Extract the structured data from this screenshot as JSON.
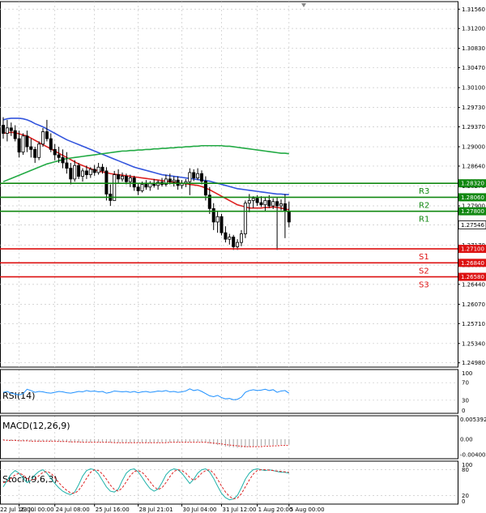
{
  "chart_data": {
    "type": "candlestick",
    "price_axis": {
      "ticks": [
        "1.31560",
        "1.31200",
        "1.30830",
        "1.30470",
        "1.30100",
        "1.29730",
        "1.29370",
        "1.29000",
        "1.28640",
        "1.28270",
        "1.27900",
        "1.27546",
        "1.27170",
        "1.26800",
        "1.26440",
        "1.26070",
        "1.25710",
        "1.25340",
        "1.24980"
      ],
      "ylim": [
        1.249,
        1.317
      ]
    },
    "time_axis": {
      "labels": [
        "22 Jul 16:00",
        "23 Jul 00:00",
        "24 Jul 08:00",
        "25 Jul 16:00",
        "28 Jul 21:01",
        "30 Jul 04:00",
        "31 Jul 12:00",
        "1 Aug 20:00",
        "5 Aug 00:00"
      ],
      "n_bars": 73
    },
    "candles": [
      {
        "o": 1.294,
        "h": 1.2955,
        "l": 1.2915,
        "c": 1.2925
      },
      {
        "o": 1.2925,
        "h": 1.295,
        "l": 1.291,
        "c": 1.2935
      },
      {
        "o": 1.2935,
        "h": 1.2945,
        "l": 1.292,
        "c": 1.293
      },
      {
        "o": 1.293,
        "h": 1.294,
        "l": 1.291,
        "c": 1.2915
      },
      {
        "o": 1.2915,
        "h": 1.293,
        "l": 1.288,
        "c": 1.289
      },
      {
        "o": 1.289,
        "h": 1.2925,
        "l": 1.2885,
        "c": 1.292
      },
      {
        "o": 1.292,
        "h": 1.293,
        "l": 1.289,
        "c": 1.29
      },
      {
        "o": 1.29,
        "h": 1.2915,
        "l": 1.288,
        "c": 1.2895
      },
      {
        "o": 1.2895,
        "h": 1.29,
        "l": 1.287,
        "c": 1.288
      },
      {
        "o": 1.288,
        "h": 1.291,
        "l": 1.2875,
        "c": 1.2905
      },
      {
        "o": 1.2905,
        "h": 1.2935,
        "l": 1.29,
        "c": 1.2928
      },
      {
        "o": 1.2928,
        "h": 1.295,
        "l": 1.291,
        "c": 1.2915
      },
      {
        "o": 1.2915,
        "h": 1.2925,
        "l": 1.289,
        "c": 1.2895
      },
      {
        "o": 1.2895,
        "h": 1.2905,
        "l": 1.2875,
        "c": 1.2885
      },
      {
        "o": 1.2885,
        "h": 1.29,
        "l": 1.287,
        "c": 1.288
      },
      {
        "o": 1.288,
        "h": 1.2895,
        "l": 1.286,
        "c": 1.287
      },
      {
        "o": 1.287,
        "h": 1.289,
        "l": 1.285,
        "c": 1.286
      },
      {
        "o": 1.286,
        "h": 1.287,
        "l": 1.283,
        "c": 1.284
      },
      {
        "o": 1.284,
        "h": 1.2875,
        "l": 1.2835,
        "c": 1.2865
      },
      {
        "o": 1.2865,
        "h": 1.287,
        "l": 1.284,
        "c": 1.2845
      },
      {
        "o": 1.2845,
        "h": 1.286,
        "l": 1.2835,
        "c": 1.2855
      },
      {
        "o": 1.2855,
        "h": 1.2865,
        "l": 1.284,
        "c": 1.2848
      },
      {
        "o": 1.2848,
        "h": 1.2862,
        "l": 1.2842,
        "c": 1.2858
      },
      {
        "o": 1.2858,
        "h": 1.2866,
        "l": 1.2846,
        "c": 1.2852
      },
      {
        "o": 1.2852,
        "h": 1.287,
        "l": 1.2848,
        "c": 1.2862
      },
      {
        "o": 1.2862,
        "h": 1.2868,
        "l": 1.285,
        "c": 1.2855
      },
      {
        "o": 1.2855,
        "h": 1.2862,
        "l": 1.28,
        "c": 1.2812
      },
      {
        "o": 1.2812,
        "h": 1.283,
        "l": 1.279,
        "c": 1.28
      },
      {
        "o": 1.28,
        "h": 1.2855,
        "l": 1.28,
        "c": 1.2848
      },
      {
        "o": 1.2848,
        "h": 1.2858,
        "l": 1.2832,
        "c": 1.284
      },
      {
        "o": 1.284,
        "h": 1.2852,
        "l": 1.2835,
        "c": 1.2845
      },
      {
        "o": 1.2845,
        "h": 1.285,
        "l": 1.283,
        "c": 1.2835
      },
      {
        "o": 1.2835,
        "h": 1.2848,
        "l": 1.2825,
        "c": 1.2842
      },
      {
        "o": 1.2842,
        "h": 1.2846,
        "l": 1.2818,
        "c": 1.2825
      },
      {
        "o": 1.2825,
        "h": 1.2832,
        "l": 1.281,
        "c": 1.2818
      },
      {
        "o": 1.2818,
        "h": 1.2835,
        "l": 1.2815,
        "c": 1.283
      },
      {
        "o": 1.283,
        "h": 1.2838,
        "l": 1.282,
        "c": 1.2825
      },
      {
        "o": 1.2825,
        "h": 1.2836,
        "l": 1.2818,
        "c": 1.2832
      },
      {
        "o": 1.2832,
        "h": 1.284,
        "l": 1.2824,
        "c": 1.2828
      },
      {
        "o": 1.2828,
        "h": 1.2838,
        "l": 1.282,
        "c": 1.2834
      },
      {
        "o": 1.2834,
        "h": 1.2842,
        "l": 1.2826,
        "c": 1.283
      },
      {
        "o": 1.283,
        "h": 1.2848,
        "l": 1.2826,
        "c": 1.284
      },
      {
        "o": 1.284,
        "h": 1.285,
        "l": 1.283,
        "c": 1.2835
      },
      {
        "o": 1.2835,
        "h": 1.2845,
        "l": 1.2826,
        "c": 1.2838
      },
      {
        "o": 1.2838,
        "h": 1.2845,
        "l": 1.282,
        "c": 1.2828
      },
      {
        "o": 1.2828,
        "h": 1.2838,
        "l": 1.2822,
        "c": 1.2832
      },
      {
        "o": 1.2832,
        "h": 1.284,
        "l": 1.2825,
        "c": 1.2835
      },
      {
        "o": 1.2835,
        "h": 1.286,
        "l": 1.281,
        "c": 1.2852
      },
      {
        "o": 1.2852,
        "h": 1.2858,
        "l": 1.2836,
        "c": 1.2842
      },
      {
        "o": 1.2842,
        "h": 1.286,
        "l": 1.2838,
        "c": 1.285
      },
      {
        "o": 1.285,
        "h": 1.2856,
        "l": 1.283,
        "c": 1.2836
      },
      {
        "o": 1.2836,
        "h": 1.2845,
        "l": 1.28,
        "c": 1.281
      },
      {
        "o": 1.281,
        "h": 1.2825,
        "l": 1.2775,
        "c": 1.2785
      },
      {
        "o": 1.2785,
        "h": 1.2795,
        "l": 1.2745,
        "c": 1.276
      },
      {
        "o": 1.276,
        "h": 1.278,
        "l": 1.274,
        "c": 1.277
      },
      {
        "o": 1.277,
        "h": 1.2775,
        "l": 1.2735,
        "c": 1.274
      },
      {
        "o": 1.274,
        "h": 1.2752,
        "l": 1.2722,
        "c": 1.2728
      },
      {
        "o": 1.2728,
        "h": 1.2738,
        "l": 1.2718,
        "c": 1.2732
      },
      {
        "o": 1.2732,
        "h": 1.2736,
        "l": 1.2708,
        "c": 1.2714
      },
      {
        "o": 1.2714,
        "h": 1.2728,
        "l": 1.2708,
        "c": 1.2722
      },
      {
        "o": 1.2722,
        "h": 1.2745,
        "l": 1.2715,
        "c": 1.2738
      },
      {
        "o": 1.2738,
        "h": 1.28,
        "l": 1.273,
        "c": 1.2795
      },
      {
        "o": 1.2795,
        "h": 1.2812,
        "l": 1.2778,
        "c": 1.28
      },
      {
        "o": 1.28,
        "h": 1.2808,
        "l": 1.2786,
        "c": 1.2804
      },
      {
        "o": 1.2804,
        "h": 1.281,
        "l": 1.279,
        "c": 1.2796
      },
      {
        "o": 1.2796,
        "h": 1.2808,
        "l": 1.2788,
        "c": 1.2792
      },
      {
        "o": 1.2792,
        "h": 1.2806,
        "l": 1.278,
        "c": 1.28
      },
      {
        "o": 1.28,
        "h": 1.281,
        "l": 1.2786,
        "c": 1.279
      },
      {
        "o": 1.279,
        "h": 1.2804,
        "l": 1.2784,
        "c": 1.2798
      },
      {
        "o": 1.2798,
        "h": 1.2806,
        "l": 1.2708,
        "c": 1.279
      },
      {
        "o": 1.279,
        "h": 1.2802,
        "l": 1.2782,
        "c": 1.2794
      },
      {
        "o": 1.2794,
        "h": 1.2812,
        "l": 1.273,
        "c": 1.278
      },
      {
        "o": 1.278,
        "h": 1.2798,
        "l": 1.275,
        "c": 1.276
      }
    ],
    "moving_averages": [
      {
        "color": "#3355dd",
        "values": [
          1.295,
          1.2952,
          1.2953,
          1.2953,
          1.2953,
          1.2952,
          1.295,
          1.2947,
          1.2943,
          1.294,
          1.2937,
          1.2933,
          1.2929,
          1.2925,
          1.2921,
          1.2917,
          1.2913,
          1.291,
          1.2907,
          1.2904,
          1.2901,
          1.2898,
          1.2895,
          1.2892,
          1.2889,
          1.2886,
          1.2883,
          1.288,
          1.2877,
          1.2874,
          1.2871,
          1.2868,
          1.2865,
          1.2862,
          1.286,
          1.2858,
          1.2856,
          1.2854,
          1.2852,
          1.285,
          1.2848,
          1.2847,
          1.2846,
          1.2845,
          1.2844,
          1.2843,
          1.2842,
          1.2841,
          1.284,
          1.2839,
          1.2838,
          1.2837,
          1.2836,
          1.2834,
          1.2832,
          1.283,
          1.2828,
          1.2826,
          1.2824,
          1.2822,
          1.2821,
          1.282,
          1.2819,
          1.2818,
          1.2817,
          1.2816,
          1.2815,
          1.2814,
          1.2813,
          1.2812,
          1.2812,
          1.2811,
          1.2811
        ]
      },
      {
        "color": "#dd2222",
        "values": [
          1.2925,
          1.2926,
          1.2927,
          1.2926,
          1.2924,
          1.2922,
          1.292,
          1.2916,
          1.2912,
          1.2908,
          1.2904,
          1.29,
          1.2896,
          1.2892,
          1.2888,
          1.2884,
          1.288,
          1.2876,
          1.2872,
          1.2868,
          1.2865,
          1.2862,
          1.2859,
          1.2857,
          1.2855,
          1.2853,
          1.2852,
          1.285,
          1.2849,
          1.2848,
          1.2847,
          1.2846,
          1.2845,
          1.2844,
          1.2843,
          1.2842,
          1.2841,
          1.284,
          1.2839,
          1.2838,
          1.2837,
          1.2836,
          1.2835,
          1.2834,
          1.2833,
          1.2832,
          1.2831,
          1.283,
          1.2829,
          1.2828,
          1.2826,
          1.2823,
          1.282,
          1.2816,
          1.2812,
          1.2808,
          1.2804,
          1.28,
          1.2796,
          1.2792,
          1.279,
          1.2788,
          1.2786,
          1.2786,
          1.2786,
          1.2786,
          1.2787,
          1.2787,
          1.2788,
          1.2787,
          1.2786,
          1.2784,
          1.2783
        ]
      },
      {
        "color": "#22aa44",
        "values": [
          1.2835,
          1.2838,
          1.2841,
          1.2844,
          1.2847,
          1.285,
          1.2853,
          1.2856,
          1.2859,
          1.2862,
          1.2865,
          1.2868,
          1.287,
          1.2872,
          1.2874,
          1.2876,
          1.2878,
          1.2879,
          1.288,
          1.2881,
          1.2882,
          1.2883,
          1.2884,
          1.2885,
          1.2886,
          1.2887,
          1.2888,
          1.2889,
          1.289,
          1.2891,
          1.2892,
          1.2892,
          1.2893,
          1.2893,
          1.2894,
          1.2894,
          1.2895,
          1.2895,
          1.2896,
          1.2896,
          1.2897,
          1.2897,
          1.2898,
          1.2898,
          1.2899,
          1.2899,
          1.29,
          1.29,
          1.2901,
          1.2901,
          1.2902,
          1.2902,
          1.2902,
          1.2902,
          1.2902,
          1.2902,
          1.2901,
          1.2901,
          1.29,
          1.2899,
          1.2898,
          1.2897,
          1.2896,
          1.2895,
          1.2894,
          1.2893,
          1.2892,
          1.2891,
          1.289,
          1.2889,
          1.2888,
          1.2888,
          1.2887
        ]
      }
    ],
    "levels": [
      {
        "label": "R3",
        "value": 1.2832,
        "tag": "1.28320",
        "color": "#118811",
        "tag_bg": "#118811"
      },
      {
        "label": "R2",
        "value": 1.2806,
        "tag": "1.28060",
        "color": "#118811",
        "tag_bg": "#118811"
      },
      {
        "label": "R1",
        "value": 1.278,
        "tag": "1.27800",
        "color": "#118811",
        "tag_bg": "#118811"
      },
      {
        "label": "S1",
        "value": 1.271,
        "tag": "1.27100",
        "color": "#dd1111",
        "tag_bg": "#dd1111"
      },
      {
        "label": "S2",
        "value": 1.2684,
        "tag": "1.26840",
        "color": "#dd1111",
        "tag_bg": "#dd1111"
      },
      {
        "label": "S3",
        "value": 1.2658,
        "tag": "1.26580",
        "color": "#dd1111",
        "tag_bg": "#dd1111"
      }
    ],
    "current_price": {
      "value": 1.27546,
      "tag": "1.27546"
    },
    "rsi": {
      "title": "RSI(14)",
      "ticks": [
        "100",
        "70",
        "30",
        "0"
      ],
      "ylim": [
        0,
        100
      ],
      "color": "#1e90ff",
      "values": [
        48,
        50,
        46,
        44,
        42,
        45,
        55,
        52,
        48,
        50,
        49,
        47,
        46,
        48,
        50,
        49,
        47,
        46,
        48,
        50,
        49,
        52,
        50,
        51,
        49,
        50,
        46,
        48,
        51,
        50,
        49,
        50,
        48,
        50,
        47,
        49,
        50,
        48,
        49,
        51,
        50,
        52,
        49,
        50,
        48,
        49,
        51,
        56,
        52,
        54,
        50,
        45,
        40,
        38,
        41,
        36,
        33,
        34,
        31,
        32,
        37,
        48,
        52,
        54,
        52,
        53,
        55,
        52,
        54,
        48,
        51,
        52,
        46
      ]
    },
    "macd": {
      "title": "MACD(12,26,9)",
      "ticks": [
        "0.005392",
        "0.00",
        "-0.004007"
      ],
      "ylim": [
        -0.005,
        0.006
      ],
      "hist_color": "#b0b0b0",
      "signal_color": "#dd2222",
      "hist": [
        -0.0003,
        -0.0003,
        -0.0004,
        -0.0004,
        -0.0005,
        -0.0005,
        -0.0005,
        -0.0005,
        -0.0006,
        -0.0006,
        -0.0005,
        -0.0005,
        -0.0005,
        -0.0006,
        -0.0006,
        -0.0007,
        -0.0007,
        -0.0008,
        -0.0008,
        -0.0008,
        -0.0008,
        -0.0008,
        -0.0008,
        -0.0008,
        -0.0008,
        -0.0008,
        -0.0009,
        -0.0009,
        -0.0009,
        -0.0009,
        -0.0009,
        -0.0009,
        -0.0009,
        -0.0009,
        -0.0009,
        -0.0009,
        -0.0009,
        -0.0009,
        -0.0009,
        -0.0009,
        -0.0008,
        -0.0008,
        -0.0008,
        -0.0008,
        -0.0008,
        -0.0008,
        -0.0008,
        -0.0007,
        -0.0007,
        -0.0007,
        -0.0008,
        -0.0009,
        -0.0011,
        -0.0013,
        -0.0015,
        -0.0017,
        -0.0019,
        -0.002,
        -0.0021,
        -0.0022,
        -0.0022,
        -0.0021,
        -0.002,
        -0.0019,
        -0.0018,
        -0.0017,
        -0.0016,
        -0.0016,
        -0.0015,
        -0.0015,
        -0.0014,
        -0.0014,
        -0.0014
      ],
      "signal": [
        -0.0002,
        -0.0003,
        -0.0003,
        -0.0003,
        -0.0004,
        -0.0004,
        -0.0004,
        -0.0005,
        -0.0005,
        -0.0005,
        -0.0005,
        -0.0005,
        -0.0005,
        -0.0005,
        -0.0006,
        -0.0006,
        -0.0006,
        -0.0007,
        -0.0007,
        -0.0007,
        -0.0008,
        -0.0008,
        -0.0008,
        -0.0008,
        -0.0008,
        -0.0008,
        -0.0008,
        -0.0008,
        -0.0009,
        -0.0009,
        -0.0009,
        -0.0009,
        -0.0009,
        -0.0009,
        -0.0009,
        -0.0009,
        -0.0009,
        -0.0009,
        -0.0009,
        -0.0009,
        -0.0009,
        -0.0009,
        -0.0008,
        -0.0008,
        -0.0008,
        -0.0008,
        -0.0008,
        -0.0008,
        -0.0008,
        -0.0008,
        -0.0008,
        -0.0008,
        -0.0009,
        -0.001,
        -0.0011,
        -0.0012,
        -0.0014,
        -0.0015,
        -0.0016,
        -0.0017,
        -0.0018,
        -0.0019,
        -0.0019,
        -0.0019,
        -0.0019,
        -0.0019,
        -0.0018,
        -0.0018,
        -0.0017,
        -0.0017,
        -0.0016,
        -0.0016,
        -0.0016
      ]
    },
    "stoch": {
      "title": "Stoch(9,6,3)",
      "ticks": [
        "100",
        "80",
        "20",
        "0"
      ],
      "ylim": [
        0,
        100
      ],
      "main_color": "#20b2aa",
      "signal_color": "#dd2222",
      "main": [
        40,
        55,
        70,
        78,
        72,
        60,
        50,
        55,
        68,
        76,
        80,
        72,
        60,
        48,
        38,
        30,
        25,
        22,
        28,
        45,
        65,
        78,
        82,
        80,
        70,
        55,
        40,
        30,
        28,
        35,
        55,
        72,
        80,
        82,
        75,
        62,
        48,
        36,
        30,
        35,
        50,
        68,
        78,
        82,
        80,
        72,
        60,
        48,
        58,
        72,
        80,
        82,
        75,
        60,
        42,
        25,
        15,
        10,
        12,
        20,
        38,
        58,
        72,
        80,
        82,
        80,
        78,
        80,
        78,
        76,
        74,
        74,
        72
      ],
      "signal": [
        50,
        52,
        60,
        68,
        72,
        68,
        60,
        56,
        58,
        66,
        74,
        76,
        72,
        62,
        50,
        40,
        32,
        26,
        25,
        32,
        45,
        60,
        74,
        80,
        78,
        70,
        58,
        44,
        34,
        30,
        38,
        52,
        66,
        76,
        78,
        74,
        64,
        52,
        40,
        34,
        38,
        50,
        64,
        76,
        80,
        78,
        72,
        62,
        55,
        62,
        72,
        78,
        80,
        72,
        58,
        42,
        28,
        18,
        12,
        14,
        24,
        40,
        56,
        70,
        78,
        80,
        80,
        79,
        78,
        77,
        76,
        75,
        74
      ]
    }
  }
}
